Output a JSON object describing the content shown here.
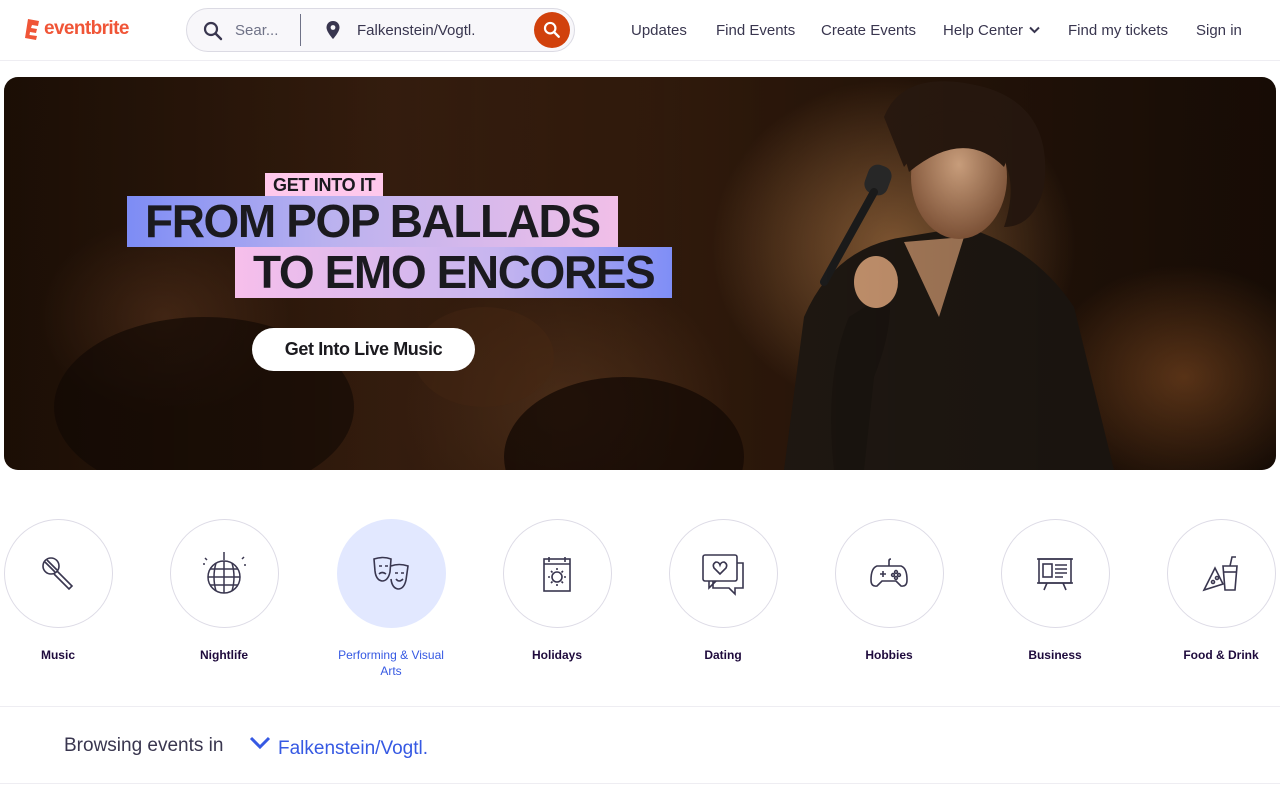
{
  "header": {
    "logo_text": "eventbrite",
    "brand_color": "#f05537",
    "search_placeholder": "Sear...",
    "location_value": "Falkenstein/Vogtl.",
    "search_button_color": "#d1410c",
    "nav": [
      {
        "label": "Updates"
      },
      {
        "label": "Find Events"
      },
      {
        "label": "Create Events"
      },
      {
        "label": "Help Center",
        "has_dropdown": true
      },
      {
        "label": "Find my tickets"
      },
      {
        "label": "Sign in"
      }
    ]
  },
  "hero": {
    "tagline": "GET INTO IT",
    "headline_line1": "FROM POP BALLADS",
    "headline_line2": "TO EMO ENCORES",
    "cta_label": "Get Into Live Music"
  },
  "categories": [
    {
      "label": "Music",
      "icon": "microphone-icon"
    },
    {
      "label": "Nightlife",
      "icon": "disco-ball-icon"
    },
    {
      "label": "Performing & Visual Arts",
      "icon": "theater-masks-icon",
      "active": true
    },
    {
      "label": "Holidays",
      "icon": "calendar-sun-icon"
    },
    {
      "label": "Dating",
      "icon": "chat-heart-icon"
    },
    {
      "label": "Hobbies",
      "icon": "gamepad-icon"
    },
    {
      "label": "Business",
      "icon": "presentation-board-icon"
    },
    {
      "label": "Food & Drink",
      "icon": "food-drink-icon"
    }
  ],
  "browse": {
    "label": "Browsing events in",
    "location": "Falkenstein/Vogtl.",
    "accent_color": "#3659e3"
  }
}
